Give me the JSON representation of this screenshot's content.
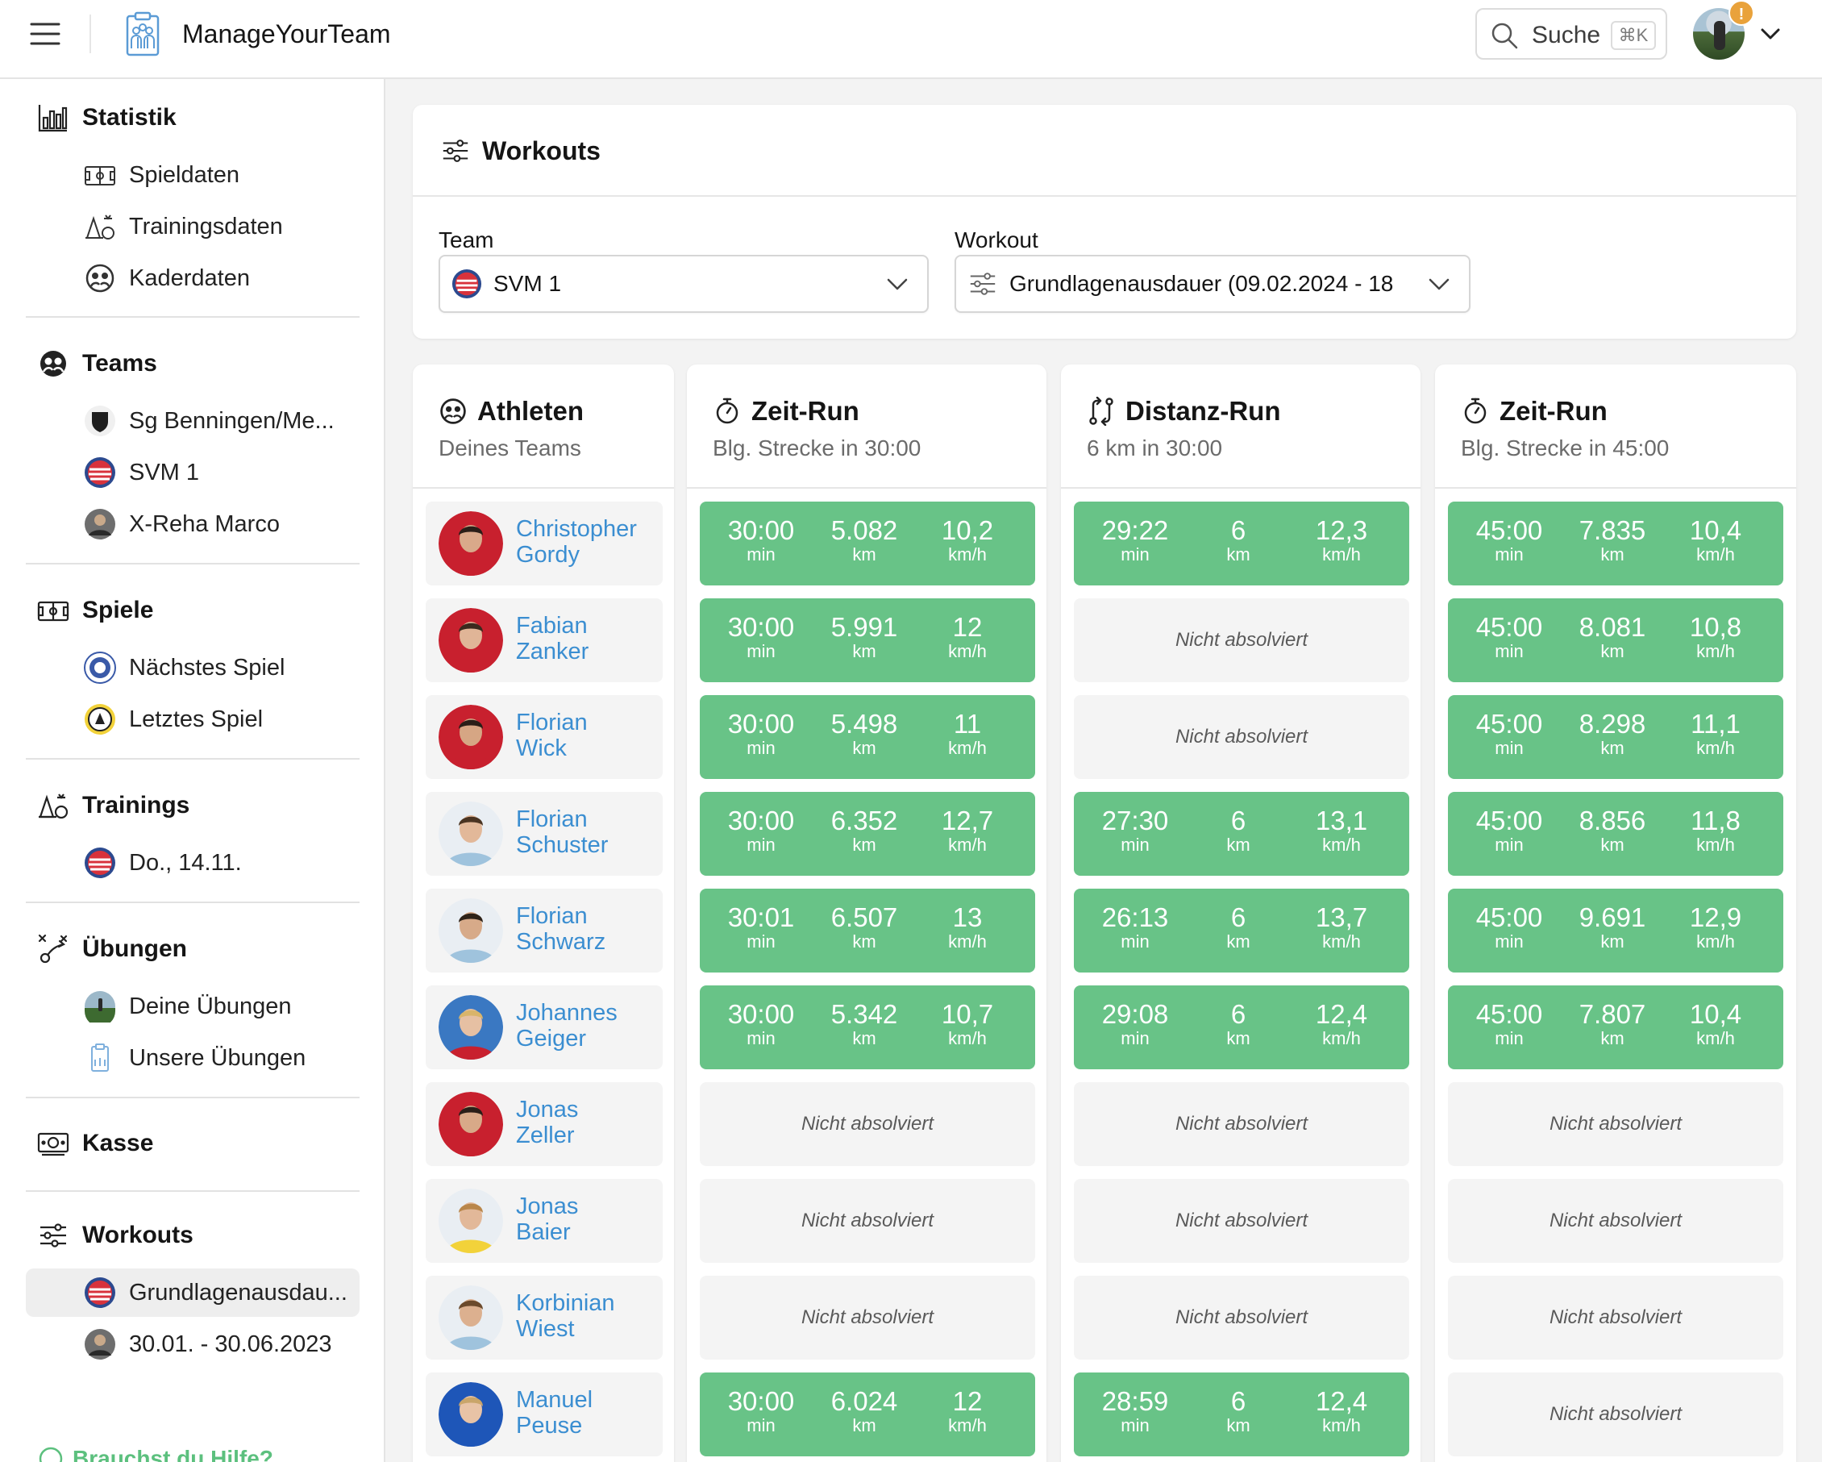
{
  "app": {
    "name": "ManageYourTeam"
  },
  "search": {
    "label": "Suche",
    "shortcut": "⌘K"
  },
  "notification_badge": "!",
  "sidebar": {
    "sections": {
      "statistik": {
        "title": "Statistik",
        "items": [
          "Spieldaten",
          "Trainingsdaten",
          "Kaderdaten"
        ]
      },
      "teams": {
        "title": "Teams",
        "items": [
          "Sg Benningen/Me...",
          "SVM 1",
          "X-Reha Marco"
        ]
      },
      "spiele": {
        "title": "Spiele",
        "items": [
          "Nächstes Spiel",
          "Letztes Spiel"
        ]
      },
      "trainings": {
        "title": "Trainings",
        "items": [
          "Do., 14.11."
        ]
      },
      "uebungen": {
        "title": "Übungen",
        "items": [
          "Deine Übungen",
          "Unsere Übungen"
        ]
      },
      "kasse": {
        "title": "Kasse"
      },
      "workouts": {
        "title": "Workouts",
        "items": [
          "Grundlagenausdau...",
          "30.01. - 30.06.2023"
        ]
      }
    },
    "help": "Brauchst du Hilfe?"
  },
  "workouts_card": {
    "title": "Workouts",
    "team_label": "Team",
    "team_value": "SVM 1",
    "workout_label": "Workout",
    "workout_value": "Grundlagenausdauer (09.02.2024 - 18"
  },
  "columns": {
    "athletes": {
      "title": "Athleten",
      "subtitle": "Deines Teams"
    },
    "runs": [
      {
        "title": "Zeit-Run",
        "subtitle": "Blg. Strecke in 30:00",
        "icon": "stopwatch-icon"
      },
      {
        "title": "Distanz-Run",
        "subtitle": "6 km in 30:00",
        "icon": "route-icon"
      },
      {
        "title": "Zeit-Run",
        "subtitle": "Blg. Strecke in 45:00",
        "icon": "stopwatch-icon"
      }
    ]
  },
  "units": {
    "time": "min",
    "distance": "km",
    "speed": "km/h"
  },
  "not_done_label": "Nicht absolviert",
  "athletes": [
    {
      "first": "Christopher",
      "last": "Gordy",
      "results": [
        [
          "30:00",
          "5.082",
          "10,2"
        ],
        [
          "29:22",
          "6",
          "12,3"
        ],
        [
          "45:00",
          "7.835",
          "10,4"
        ]
      ]
    },
    {
      "first": "Fabian",
      "last": "Zanker",
      "results": [
        [
          "30:00",
          "5.991",
          "12"
        ],
        null,
        [
          "45:00",
          "8.081",
          "10,8"
        ]
      ]
    },
    {
      "first": "Florian",
      "last": "Wick",
      "results": [
        [
          "30:00",
          "5.498",
          "11"
        ],
        null,
        [
          "45:00",
          "8.298",
          "11,1"
        ]
      ]
    },
    {
      "first": "Florian",
      "last": "Schuster",
      "results": [
        [
          "30:00",
          "6.352",
          "12,7"
        ],
        [
          "27:30",
          "6",
          "13,1"
        ],
        [
          "45:00",
          "8.856",
          "11,8"
        ]
      ]
    },
    {
      "first": "Florian",
      "last": "Schwarz",
      "results": [
        [
          "30:01",
          "6.507",
          "13"
        ],
        [
          "26:13",
          "6",
          "13,7"
        ],
        [
          "45:00",
          "9.691",
          "12,9"
        ]
      ]
    },
    {
      "first": "Johannes",
      "last": "Geiger",
      "results": [
        [
          "30:00",
          "5.342",
          "10,7"
        ],
        [
          "29:08",
          "6",
          "12,4"
        ],
        [
          "45:00",
          "7.807",
          "10,4"
        ]
      ]
    },
    {
      "first": "Jonas",
      "last": "Zeller",
      "results": [
        null,
        null,
        null
      ]
    },
    {
      "first": "Jonas",
      "last": "Baier",
      "results": [
        null,
        null,
        null
      ]
    },
    {
      "first": "Korbinian",
      "last": "Wiest",
      "results": [
        null,
        null,
        null
      ]
    },
    {
      "first": "Manuel",
      "last": "Peuse",
      "results": [
        [
          "30:00",
          "6.024",
          "12"
        ],
        [
          "28:59",
          "6",
          "12,4"
        ],
        null
      ]
    }
  ],
  "colors": {
    "done": "#68c387",
    "link": "#3b8ed1",
    "accent": "#5cc07e"
  }
}
